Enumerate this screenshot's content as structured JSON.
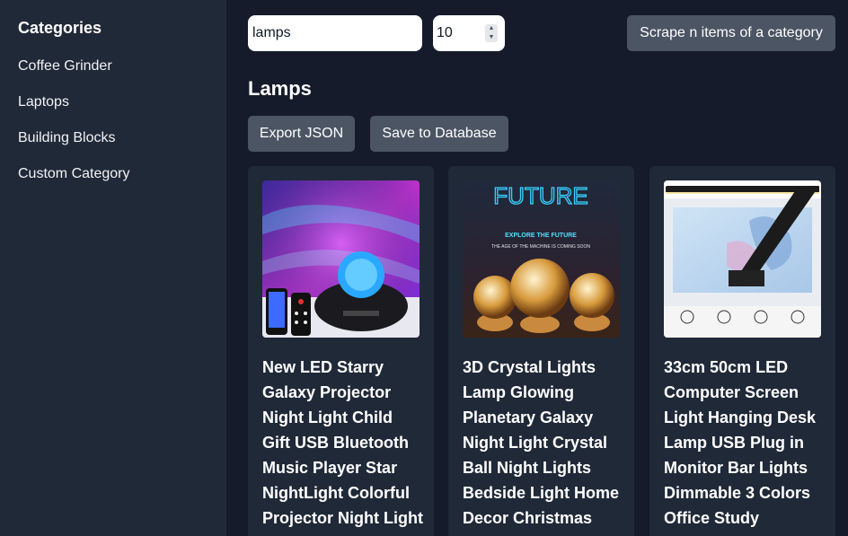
{
  "sidebar": {
    "title": "Categories",
    "items": [
      {
        "label": "Coffee Grinder"
      },
      {
        "label": "Laptops"
      },
      {
        "label": "Building Blocks"
      },
      {
        "label": "Custom Category"
      }
    ]
  },
  "toolbar": {
    "search_value": "lamps",
    "count_value": "10",
    "scrape_label": "Scrape n items of a category"
  },
  "main": {
    "category_title": "Lamps",
    "export_label": "Export JSON",
    "save_label": "Save to Database"
  },
  "products": [
    {
      "name": "New LED Starry Galaxy Projector Night Light Child Gift USB Bluetooth Music Player Star NightLight Colorful Projector Night Light"
    },
    {
      "name": "3D Crystal Lights Lamp Glowing Planetary Galaxy Night Light Crystal Ball Night Lights Bedside Light Home Decor Christmas Gift"
    },
    {
      "name": "33cm 50cm LED Computer Screen Light Hanging Desk Lamp USB Plug in Monitor Bar Lights Dimmable 3 Colors Office Study Reading Lamp"
    }
  ],
  "image_text": {
    "future": "FUTURE",
    "explore": "EXPLORE THE FUTURE",
    "age": "THE AGE OF THE MACHINE IS COMING SOON"
  },
  "colors": {
    "background": "#151b2a",
    "panel": "#202938",
    "button": "#4b5563"
  }
}
